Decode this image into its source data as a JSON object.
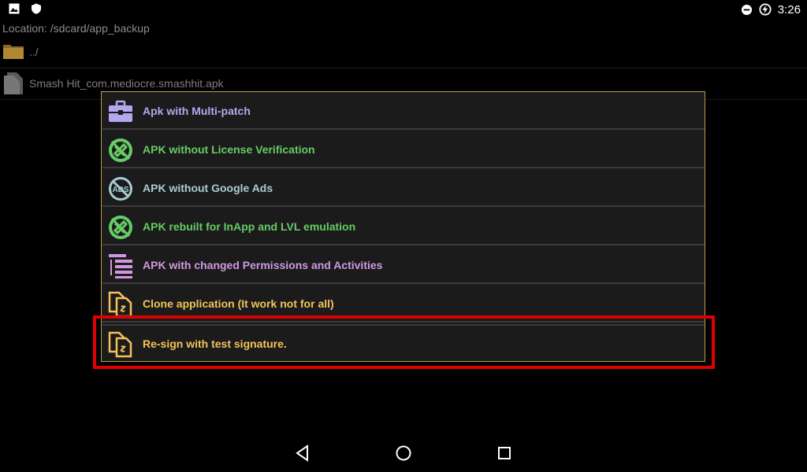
{
  "status_bar": {
    "time": "3:26",
    "icons_left": [
      "image-icon",
      "shield-icon"
    ],
    "icons_right": [
      "do-not-disturb-icon",
      "battery-charging-icon"
    ]
  },
  "file_browser": {
    "location": "Location: /sdcard/app_backup",
    "items": [
      {
        "name": "../",
        "icon": "folder-icon"
      },
      {
        "name": "Smash Hit_com.mediocre.smashhit.apk",
        "icon": "file-icon"
      }
    ]
  },
  "menu": {
    "items": [
      {
        "label": "Apk with Multi-patch",
        "color": "#b4a7ef",
        "icon": "toolbox-icon"
      },
      {
        "label": "APK without License Verification",
        "color": "#66cc66",
        "icon": "no-license-icon"
      },
      {
        "label": "APK without Google Ads",
        "color": "#a8ccd6",
        "icon": "no-ads-icon"
      },
      {
        "label": "APK rebuilt for InApp and LVL emulation",
        "color": "#66cc66",
        "icon": "no-license-icon"
      },
      {
        "label": "APK with changed Permissions and Activities",
        "color": "#d098e2",
        "icon": "permissions-list-icon"
      },
      {
        "label": "Clone application (It work not for all)",
        "color": "#f5c25a",
        "icon": "clone-icon"
      },
      {
        "label": "Re-sign with test signature.",
        "color": "#f5c25a",
        "icon": "clone-icon"
      }
    ]
  },
  "colors": {
    "highlight": "#e00000",
    "dialog_border": "#b89d4f"
  },
  "nav_bar": {
    "buttons": [
      "back-icon",
      "home-icon",
      "recents-icon"
    ]
  }
}
